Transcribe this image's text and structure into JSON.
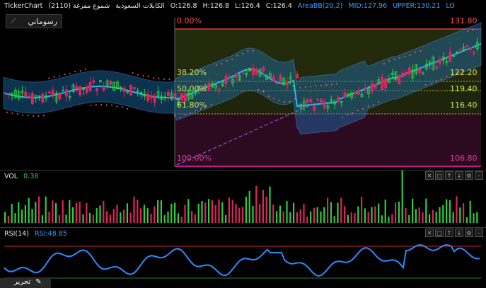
{
  "header": {
    "ticker": "TickerChart",
    "symbol": "(2110) الكابلات السعودية",
    "chart_type": "شموع مفرغة",
    "open": "O:126.8",
    "high": "H:126.8",
    "low": "L:126.4",
    "close": "C:126.4",
    "indicator": "AreaBB(20,2)",
    "mid": "MID:127.96",
    "upper": "UPPER:130.21",
    "lower": "LO"
  },
  "drawing_tool": {
    "label": "رسوماتي"
  },
  "fibonacci": {
    "levels_left": [
      "0.00%",
      "38.20%",
      "50.00%",
      "61.80%",
      "100.00%"
    ],
    "levels_right": [
      "131.80",
      "122.20",
      "119.40",
      "116.40",
      "106.80"
    ]
  },
  "volume": {
    "title": "VOL",
    "value": "0.38"
  },
  "rsi": {
    "title": "RSI(14)",
    "value": "RSI:48.85"
  },
  "edit_tab": {
    "label": "تحرير"
  },
  "controls": [
    "close",
    "restore",
    "up",
    "down",
    "settings",
    "minimize"
  ],
  "colors": {
    "up": "#2ecc40",
    "down": "#e0245e",
    "band": "#1e90ff",
    "fib_top": "#e53935",
    "fib_bottom": "#c2188b",
    "rsi_line": "#2b8cff",
    "ma": "#29b6f6"
  }
}
